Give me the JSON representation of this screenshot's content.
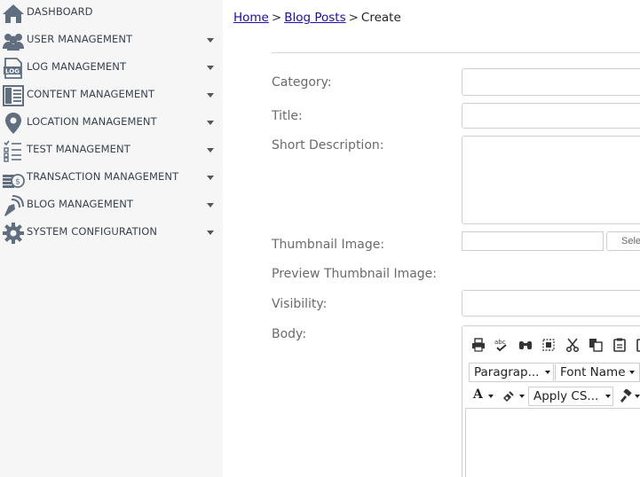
{
  "sidebar": {
    "items": [
      {
        "label": "DASHBOARD",
        "icon": "home-icon",
        "has_caret": false
      },
      {
        "label": "USER MANAGEMENT",
        "icon": "users-icon",
        "has_caret": true
      },
      {
        "label": "LOG MANAGEMENT",
        "icon": "log-icon",
        "has_caret": true
      },
      {
        "label": "CONTENT MANAGEMENT",
        "icon": "content-icon",
        "has_caret": true
      },
      {
        "label": "LOCATION MANAGEMENT",
        "icon": "location-pin-icon",
        "has_caret": true
      },
      {
        "label": "TEST MANAGEMENT",
        "icon": "checklist-icon",
        "has_caret": true
      },
      {
        "label": "TRANSACTION MANAGEMENT",
        "icon": "coins-icon",
        "has_caret": true
      },
      {
        "label": "BLOG MANAGEMENT",
        "icon": "pen-nib-icon",
        "has_caret": true
      },
      {
        "label": "SYSTEM CONFIGURATION",
        "icon": "gear-icon",
        "has_caret": true
      }
    ]
  },
  "breadcrumb": {
    "home": "Home",
    "sep1": ">",
    "blog_posts": "Blog Posts",
    "sep2": ">",
    "current": "Create"
  },
  "form": {
    "category_label": "Category:",
    "title_label": "Title:",
    "short_description_label": "Short Description:",
    "thumbnail_label": "Thumbnail Image:",
    "select_button": "Sele",
    "preview_label": "Preview Thumbnail Image:",
    "visibility_label": "Visibility:",
    "body_label": "Body:"
  },
  "editor": {
    "paragraph_select": "Paragrap...",
    "font_name_select": "Font Name",
    "apply_css_select": "Apply CS...",
    "font_color_glyph": "A"
  },
  "colors": {
    "sidebar_bg": "#f6f6f6",
    "icon": "#5f6f80",
    "link": "#1a0dab",
    "label": "#6b6b6b"
  }
}
